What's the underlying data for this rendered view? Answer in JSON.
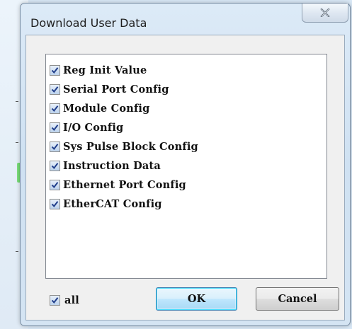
{
  "dialog": {
    "title": "Download User Data",
    "close_glyph": "close-x-icon"
  },
  "config_list": {
    "items": [
      {
        "label": "Reg Init Value",
        "checked": true
      },
      {
        "label": "Serial Port Config",
        "checked": true
      },
      {
        "label": "Module Config",
        "checked": true
      },
      {
        "label": "I/O Config",
        "checked": true
      },
      {
        "label": "Sys Pulse Block Config",
        "checked": true
      },
      {
        "label": "Instruction Data",
        "checked": true
      },
      {
        "label": "Ethernet Port Config",
        "checked": true
      },
      {
        "label": "EtherCAT Config",
        "checked": true
      }
    ]
  },
  "footer": {
    "all_label": "all",
    "all_checked": true,
    "ok_label": "OK",
    "cancel_label": "Cancel"
  },
  "colors": {
    "check_mark": "#1f3d8a",
    "ok_border": "#3c7fb1",
    "dialog_frame": "#cfe1f2"
  }
}
